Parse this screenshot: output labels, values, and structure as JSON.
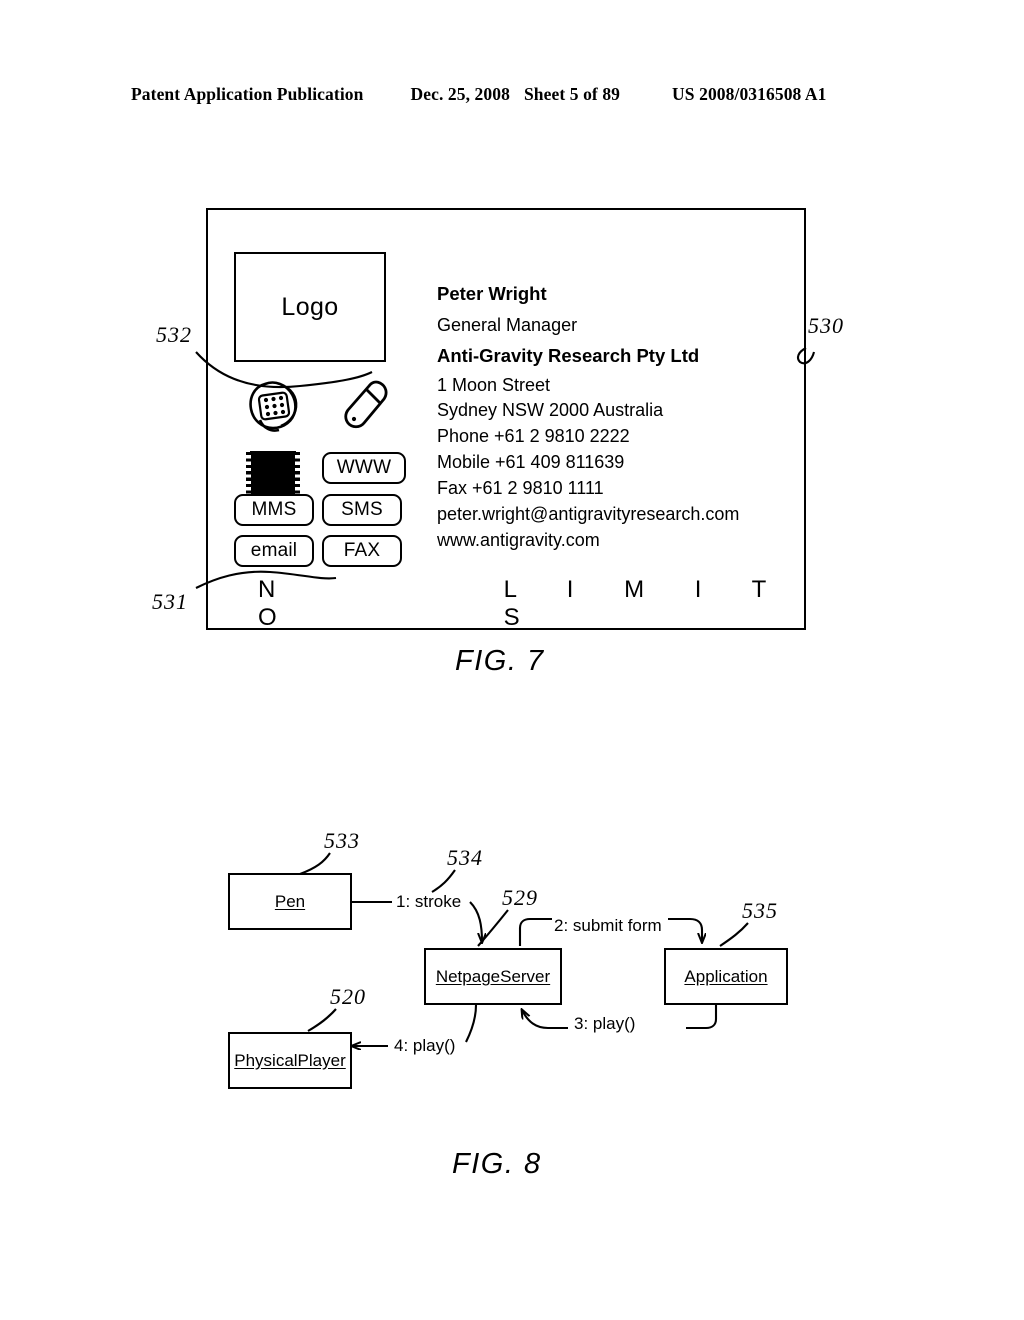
{
  "header": {
    "publication": "Patent Application Publication",
    "date": "Dec. 25, 2008",
    "sheet": "Sheet 5 of 89",
    "number": "US 2008/0316508 A1"
  },
  "fig7": {
    "caption": "FIG. 7",
    "logo_label": "Logo",
    "contact": {
      "name": "Peter Wright",
      "title": "General Manager",
      "company": "Anti-Gravity Research Pty Ltd",
      "address_line1": "1 Moon Street",
      "address_line2": "Sydney NSW 2000 Australia",
      "phone": "Phone +61 2 9810 2222",
      "mobile": "Mobile +61 409 811639",
      "fax": "Fax +61 2 9810 1111",
      "email": "peter.wright@antigravityresearch.com",
      "web": "www.antigravity.com"
    },
    "buttons": [
      {
        "label": "WWW"
      },
      {
        "label": "MMS"
      },
      {
        "label": "SMS"
      },
      {
        "label": "email"
      },
      {
        "label": "FAX"
      }
    ],
    "tagline": {
      "part1": "N O",
      "part2": "L I M I T S"
    },
    "refs": {
      "card": "530",
      "icons": "532",
      "tagline": "531"
    }
  },
  "fig8": {
    "caption": "FIG. 8",
    "nodes": [
      {
        "id": "pen",
        "label": "Pen",
        "ref": "533"
      },
      {
        "id": "netpageserver",
        "label": "NetpageServer",
        "ref": "529"
      },
      {
        "id": "application",
        "label": "Application",
        "ref": "535"
      },
      {
        "id": "physicalplayer",
        "label": "PhysicalPlayer",
        "ref": "520"
      }
    ],
    "messages": [
      {
        "id": "m1",
        "label": "1: stroke",
        "ref": "534"
      },
      {
        "id": "m2",
        "label": "2: submit form"
      },
      {
        "id": "m3",
        "label": "3: play()"
      },
      {
        "id": "m4",
        "label": "4: play()"
      }
    ]
  },
  "colors": {
    "ink": "#000000",
    "paper": "#ffffff"
  }
}
